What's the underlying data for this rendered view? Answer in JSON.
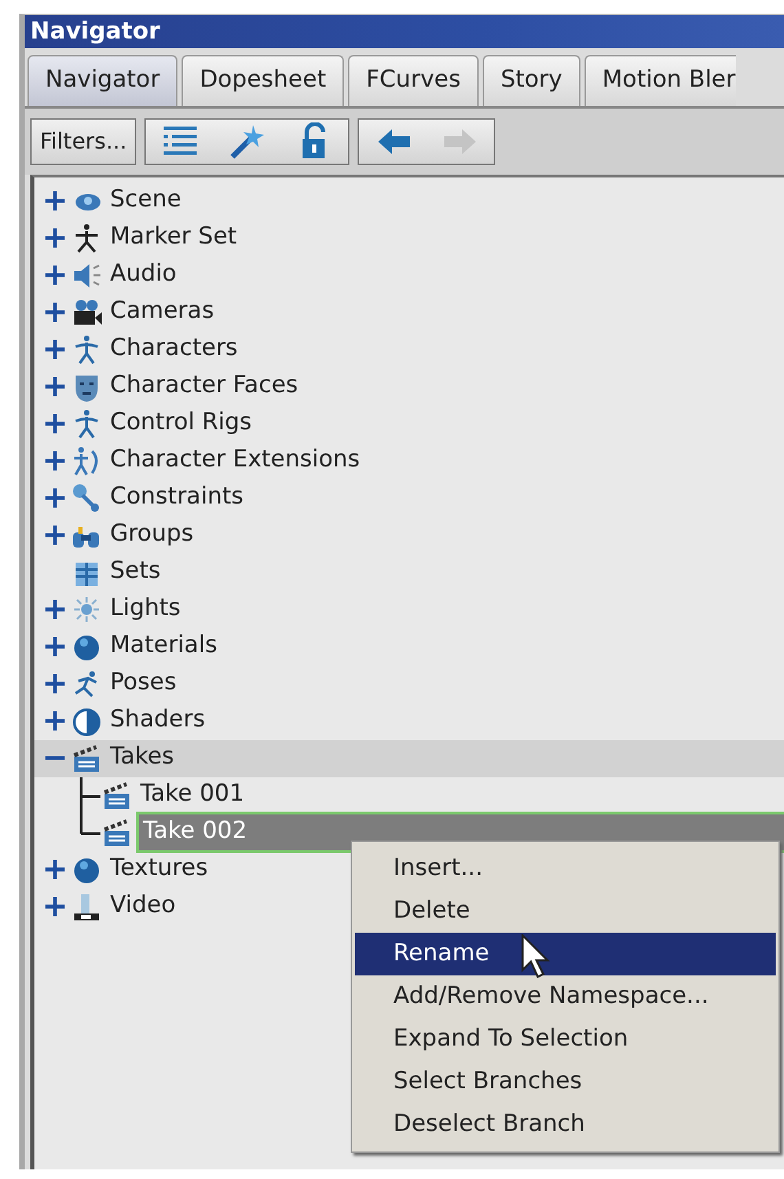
{
  "window": {
    "title": "Navigator"
  },
  "tabs": [
    {
      "label": "Navigator",
      "selected": true
    },
    {
      "label": "Dopesheet",
      "selected": false
    },
    {
      "label": "FCurves",
      "selected": false
    },
    {
      "label": "Story",
      "selected": false
    },
    {
      "label": "Motion Bler",
      "selected": false
    }
  ],
  "toolbar": {
    "filters_button": "Filters...",
    "back_enabled": true,
    "forward_enabled": false
  },
  "tree": [
    {
      "label": "Scene",
      "kind": "branch",
      "expanded": false,
      "selected": false,
      "highlighted": false
    },
    {
      "label": "Marker Set",
      "kind": "branch",
      "expanded": false,
      "selected": false,
      "highlighted": false
    },
    {
      "label": "Audio",
      "kind": "branch",
      "expanded": false,
      "selected": false,
      "highlighted": false
    },
    {
      "label": "Cameras",
      "kind": "branch",
      "expanded": false,
      "selected": false,
      "highlighted": false
    },
    {
      "label": "Characters",
      "kind": "branch",
      "expanded": false,
      "selected": false,
      "highlighted": false
    },
    {
      "label": "Character Faces",
      "kind": "branch",
      "expanded": false,
      "selected": false,
      "highlighted": false
    },
    {
      "label": "Control Rigs",
      "kind": "branch",
      "expanded": false,
      "selected": false,
      "highlighted": false
    },
    {
      "label": "Character Extensions",
      "kind": "branch",
      "expanded": false,
      "selected": false,
      "highlighted": false
    },
    {
      "label": "Constraints",
      "kind": "branch",
      "expanded": false,
      "selected": false,
      "highlighted": false
    },
    {
      "label": "Groups",
      "kind": "branch",
      "expanded": false,
      "selected": false,
      "highlighted": false
    },
    {
      "label": "Sets",
      "kind": "leaf",
      "selected": false,
      "highlighted": false
    },
    {
      "label": "Lights",
      "kind": "branch",
      "expanded": false,
      "selected": false,
      "highlighted": false
    },
    {
      "label": "Materials",
      "kind": "branch",
      "expanded": false,
      "selected": false,
      "highlighted": false
    },
    {
      "label": "Poses",
      "kind": "branch",
      "expanded": false,
      "selected": false,
      "highlighted": false
    },
    {
      "label": "Shaders",
      "kind": "branch",
      "expanded": false,
      "selected": false,
      "highlighted": false
    },
    {
      "label": "Takes",
      "kind": "branch",
      "expanded": true,
      "selected": false,
      "highlighted": true,
      "children": [
        {
          "label": "Take 001",
          "selected": false,
          "highlighted": false
        },
        {
          "label": "Take 002",
          "selected": true,
          "highlighted": false
        }
      ]
    },
    {
      "label": "Textures",
      "kind": "branch",
      "expanded": false,
      "selected": false,
      "highlighted": false
    },
    {
      "label": "Video",
      "kind": "branch",
      "expanded": false,
      "selected": false,
      "highlighted": false
    }
  ],
  "context_menu": [
    {
      "label": "Insert...",
      "selected": false
    },
    {
      "label": "Delete",
      "selected": false
    },
    {
      "label": "Rename",
      "selected": true
    },
    {
      "label": "Add/Remove Namespace...",
      "selected": false
    },
    {
      "label": "Expand To Selection",
      "selected": false
    },
    {
      "label": "Select Branches",
      "selected": false
    },
    {
      "label": "Deselect Branch",
      "selected": false
    }
  ]
}
